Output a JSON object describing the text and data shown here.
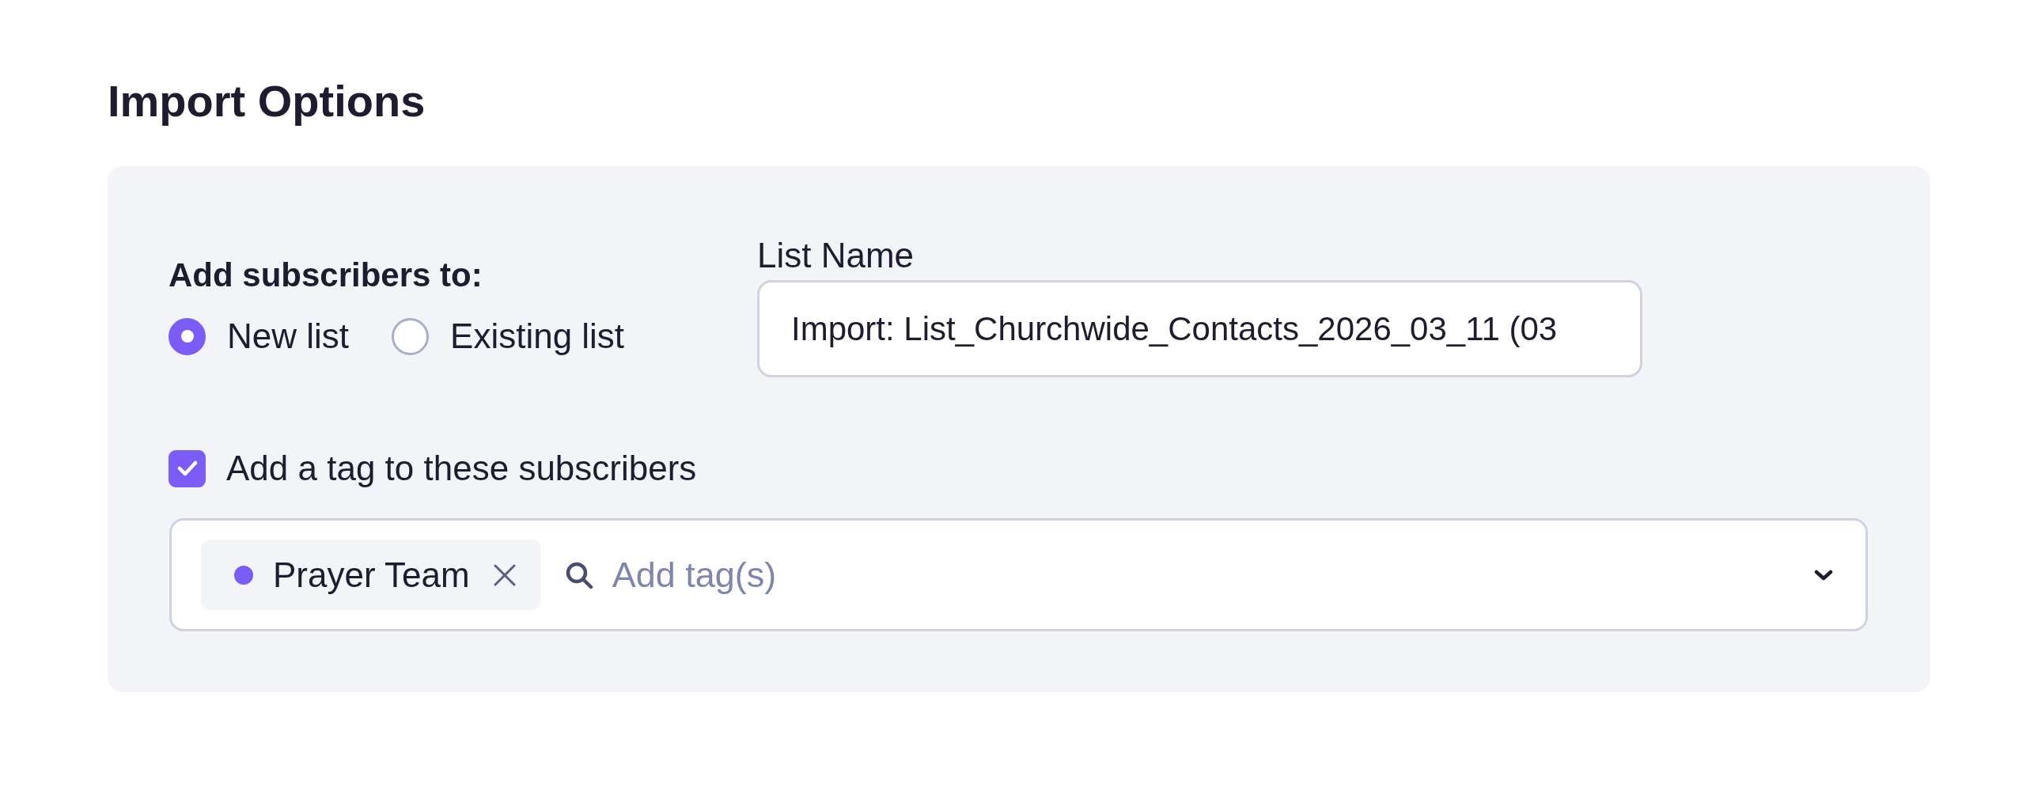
{
  "title": "Import Options",
  "destination": {
    "label": "Add subscribers to:",
    "options": [
      {
        "label": "New list",
        "selected": true
      },
      {
        "label": "Existing list",
        "selected": false
      }
    ]
  },
  "list_name": {
    "label": "List Name",
    "value": "Import: List_Churchwide_Contacts_2026_03_11 (03"
  },
  "tagging": {
    "label": "Add a tag to these subscribers",
    "checked": true,
    "tags": [
      {
        "label": "Prayer Team",
        "color": "#7b5cf6"
      }
    ],
    "placeholder": "Add tag(s)"
  }
}
